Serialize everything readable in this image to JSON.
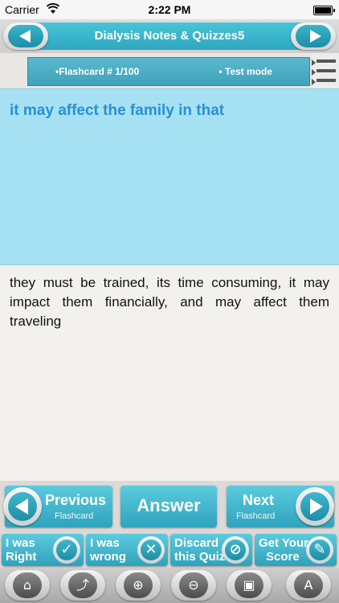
{
  "status_bar": {
    "carrier": "Carrier",
    "time": "2:22 PM"
  },
  "header": {
    "title": "Dialysis Notes & Quizzes5"
  },
  "info": {
    "flashcard": "•Flashcard #  1/100",
    "mode": "• Test mode"
  },
  "question": {
    "text": "it may affect the family in that"
  },
  "answer": {
    "text": "they must be trained, its time consuming, it may impact them financially, and may affect them traveling"
  },
  "nav": {
    "previous_label": "Previous",
    "previous_sub": "Flashcard",
    "answer_label": "Answer",
    "next_label": "Next",
    "next_sub": "Flashcard"
  },
  "actions": {
    "right_line1": "I was",
    "right_line2": "Right",
    "wrong_line1": "I was",
    "wrong_line2": "wrong",
    "discard_line1": "Discard",
    "discard_line2": "this Quiz",
    "score_line1": "Get Your",
    "score_line2": "Score"
  },
  "toolbar": {
    "icons": [
      "home-icon",
      "share-icon",
      "zoom-in-icon",
      "zoom-out-icon",
      "image-icon",
      "font-icon"
    ]
  },
  "colors": {
    "accent": "#2ea8bf",
    "question_bg": "#a6e1f3",
    "question_text": "#2a8fd6"
  }
}
